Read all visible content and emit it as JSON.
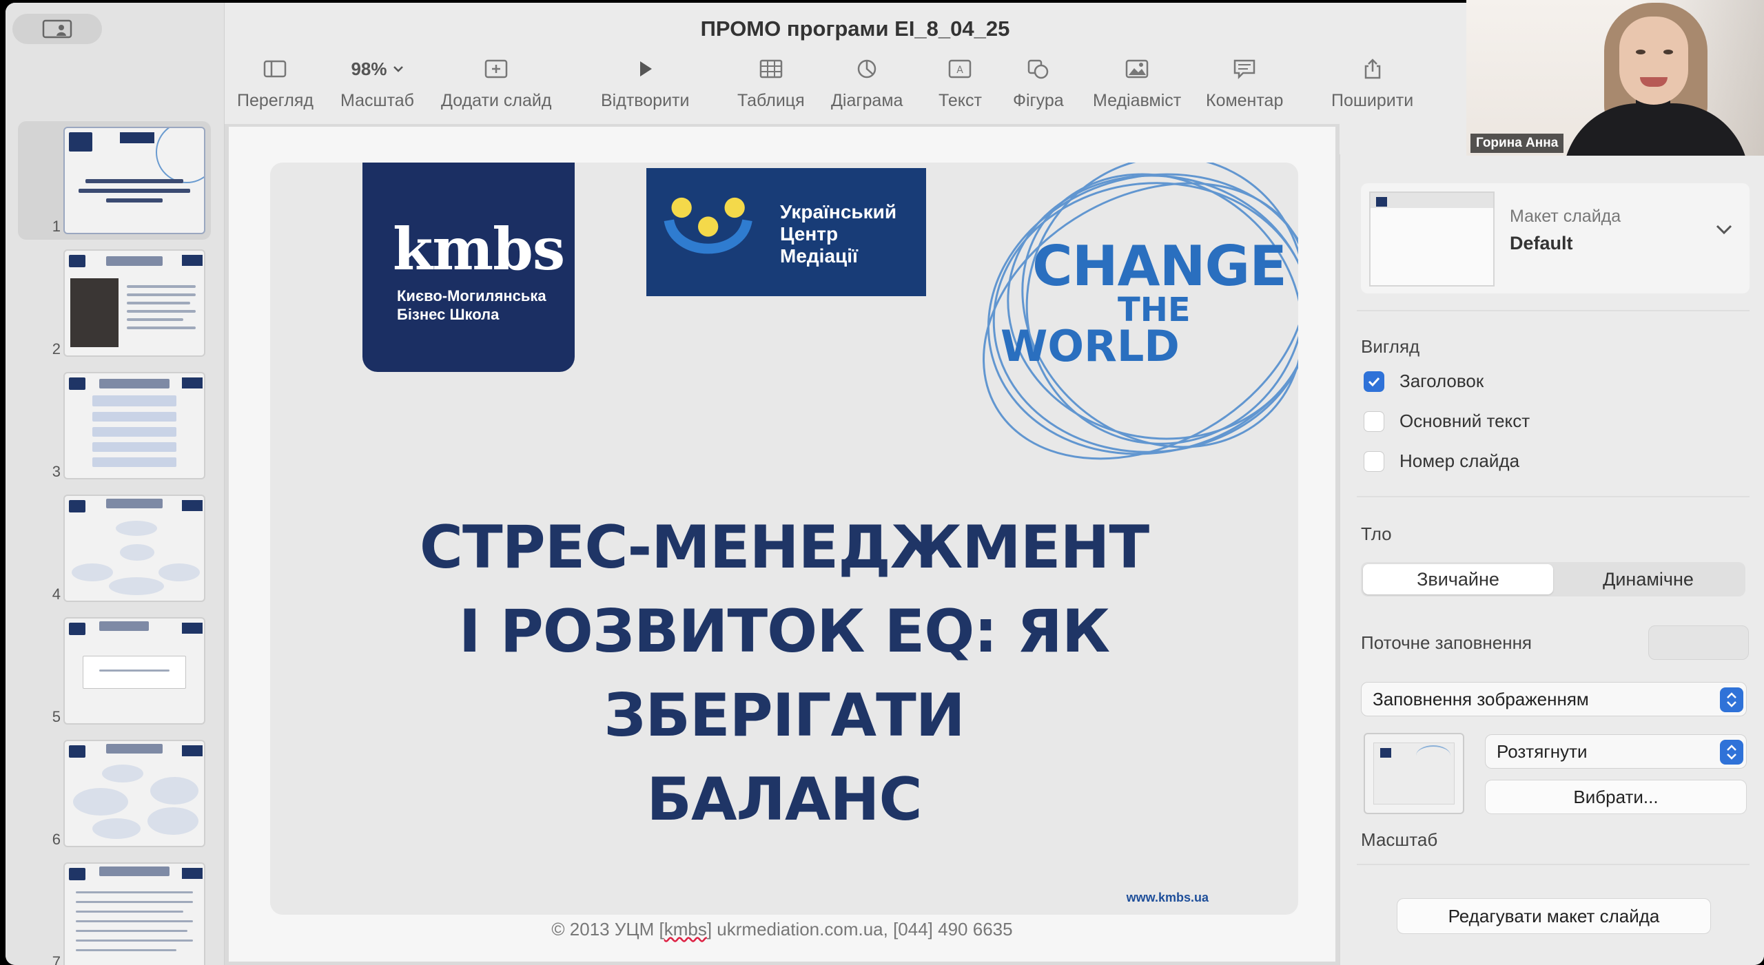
{
  "window": {
    "title": "ПРОМО програми EI_8_04_25"
  },
  "toolbar": {
    "view_label": "Перегляд",
    "zoom_value": "98%",
    "zoom_label": "Масштаб",
    "add_slide_label": "Додати слайд",
    "play_label": "Відтворити",
    "table_label": "Таблиця",
    "chart_label": "Діаграма",
    "text_label": "Текст",
    "shape_label": "Фігура",
    "media_label": "Медіавміст",
    "comment_label": "Коментар",
    "share_label": "Поширити"
  },
  "sidebar": {
    "slides": [
      {
        "number": "1",
        "selected": true
      },
      {
        "number": "2",
        "selected": false
      },
      {
        "number": "3",
        "selected": false
      },
      {
        "number": "4",
        "selected": false
      },
      {
        "number": "5",
        "selected": false
      },
      {
        "number": "6",
        "selected": false
      },
      {
        "number": "7",
        "selected": false
      }
    ]
  },
  "slide": {
    "kmbs_logo": "kmbs",
    "kmbs_subtitle_1": "Києво-Могилянська",
    "kmbs_subtitle_2": "Бізнес Школа",
    "ucm_line_1": "Український",
    "ucm_line_2": "Центр",
    "ucm_line_3": "Медіації",
    "change_1": "CHANGE",
    "change_2": "THE",
    "change_3": "WORLD",
    "heading_line_1": "СТРЕС-МЕНЕДЖМЕНТ",
    "heading_line_2": "І РОЗВИТОК EQ: ЯК ЗБЕРІГАТИ",
    "heading_line_3": "БАЛАНС",
    "site_url": "www.kmbs.ua",
    "footer_before": "© 2013 УЦМ [",
    "footer_kmbs": "kmbs",
    "footer_after": "] ukrmediation.com.ua,  [044]  490 6635"
  },
  "inspector": {
    "layout_label": "Макет слайда",
    "layout_value": "Default",
    "appearance_title": "Вигляд",
    "check_title": "Заголовок",
    "check_body": "Основний текст",
    "check_slide_number": "Номер слайда",
    "background_title": "Тло",
    "bg_standard": "Звичайне",
    "bg_dynamic": "Динамічне",
    "current_fill_label": "Поточне заповнення",
    "fill_type": "Заповнення зображенням",
    "fill_mode": "Розтягнути",
    "choose_button": "Вибрати...",
    "scale_label": "Масштаб",
    "edit_layout_button": "Редагувати макет слайда",
    "checks": {
      "title": true,
      "body": false,
      "slide_number": false
    }
  },
  "video": {
    "participant_name": "Горина Анна"
  },
  "colors": {
    "accent": "#2f72d8",
    "kmbs_navy": "#1b2f63",
    "heading_navy": "#1f3566",
    "change_blue": "#2a6fbf"
  },
  "icons": [
    "presenter-icon",
    "sidebar-view-icon",
    "chevron-down-icon",
    "add-slide-icon",
    "play-icon",
    "table-icon",
    "chart-icon",
    "text-box-icon",
    "shapes-icon",
    "media-icon",
    "comment-icon",
    "share-icon",
    "checkmark-icon",
    "stepper-arrows-icon"
  ]
}
